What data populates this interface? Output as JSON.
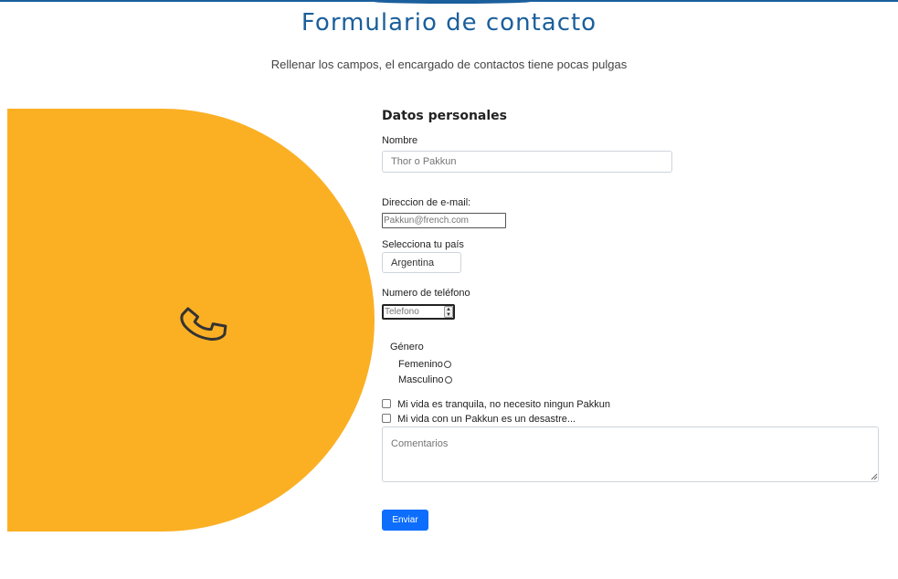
{
  "header": {
    "title": "Formulario de contacto",
    "subtitle": "Rellenar los campos, el encargado de contactos tiene pocas pulgas"
  },
  "illustration": {
    "icon": "phone-icon",
    "panel_color": "#fbb024",
    "icon_color": "#333333"
  },
  "form": {
    "section_title": "Datos personales",
    "name": {
      "label": "Nombre",
      "placeholder": "Thor o Pakkun"
    },
    "email": {
      "label": "Direccion de e-mail:",
      "placeholder": "Pakkun@french.com"
    },
    "country": {
      "label": "Selecciona tu país",
      "selected": "Argentina"
    },
    "phone": {
      "label": "Numero de teléfono",
      "placeholder": "Telefono"
    },
    "gender": {
      "label": "Género",
      "options": [
        "Femenino",
        "Masculino"
      ]
    },
    "checkboxes": [
      "Mi vida es tranquila, no necesito ningun Pakkun",
      "Mi vida con un Pakkun es un desastre..."
    ],
    "comments": {
      "placeholder": "Comentarios"
    },
    "submit_label": "Enviar"
  },
  "colors": {
    "title": "#1b5f9c",
    "accent": "#0d6efd"
  }
}
